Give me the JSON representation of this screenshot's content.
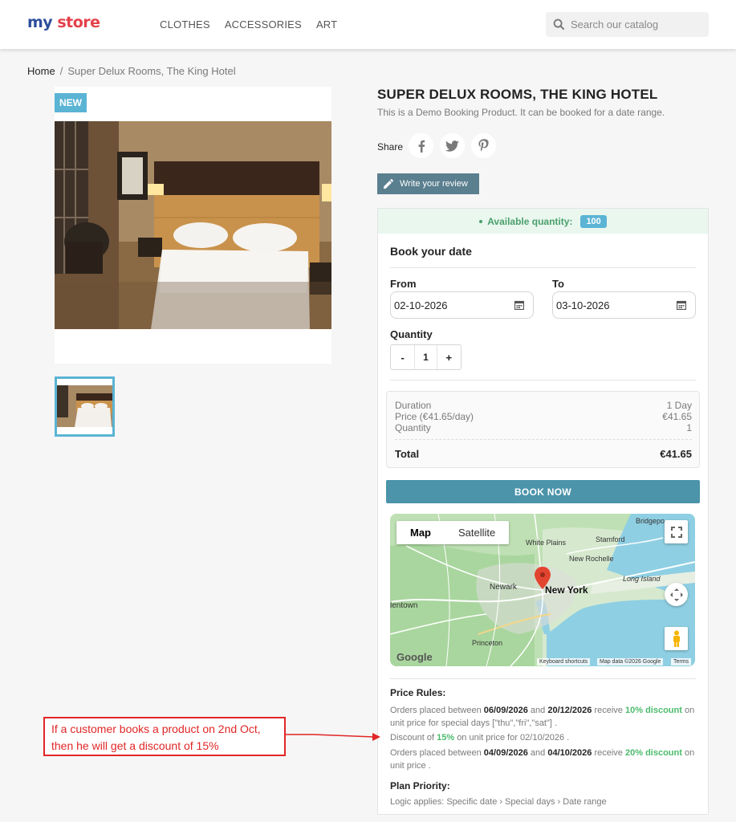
{
  "header": {
    "logo_my": "my",
    "logo_store": "store",
    "nav": [
      "CLOTHES",
      "ACCESSORIES",
      "ART"
    ],
    "search_placeholder": "Search our catalog"
  },
  "breadcrumb": {
    "home": "Home",
    "separator": "/",
    "current": "Super Delux Rooms, The King Hotel"
  },
  "product": {
    "badge": "NEW",
    "title": "SUPER DELUX ROOMS, THE KING HOTEL",
    "subtitle": "This is a Demo Booking Product. It can be booked for a date range.",
    "share_label": "Share",
    "social_icons": [
      "facebook-icon",
      "twitter-icon",
      "pinterest-icon"
    ],
    "review_button": "Write your review"
  },
  "booking": {
    "available_label": "Available quantity:",
    "available_qty": "100",
    "heading": "Book your date",
    "from_label": "From",
    "from_value": "02-10-2026",
    "to_label": "To",
    "to_value": "03-10-2026",
    "quantity_label": "Quantity",
    "qty_minus": "-",
    "qty_value": "1",
    "qty_plus": "+",
    "summary": {
      "duration_label": "Duration",
      "duration_value": "1 Day",
      "price_label": "Price (€41.65/day)",
      "price_value": "€41.65",
      "quantity_label": "Quantity",
      "quantity_value": "1",
      "total_label": "Total",
      "total_value": "€41.65"
    },
    "book_button": "BOOK NOW"
  },
  "map": {
    "type_map": "Map",
    "type_satellite": "Satellite",
    "labels": {
      "bridgeport": "Bridgepo",
      "white_plains": "White Plains",
      "stamford": "Stamford",
      "new_rochelle": "New Rochelle",
      "long_island": "Long Island",
      "newark": "Newark",
      "new_york": "New York",
      "allentown": "lentown",
      "princeton": "Princeton"
    },
    "google": "Google",
    "shortcuts": "Keyboard shortcuts",
    "map_data": "Map data ©2026 Google",
    "terms": "Terms"
  },
  "rules": {
    "title": "Price Rules:",
    "r1": {
      "pre": "Orders placed between",
      "d1": "06/09/2026",
      "and": "and",
      "d2": "20/12/2026",
      "receive": "receive",
      "disc": "10% discount",
      "post": "on unit price for special days [\"thu\",\"fri\",\"sat\"] ."
    },
    "r2": {
      "pre": "Discount of",
      "disc": "15%",
      "post": "on unit price for 02/10/2026 ."
    },
    "r3": {
      "pre": "Orders placed between",
      "d1": "04/09/2026",
      "and": "and",
      "d2": "04/10/2026",
      "receive": "receive",
      "disc": "20% discount",
      "post": "on unit price ."
    },
    "plan_title": "Plan Priority:",
    "plan_text": "Logic applies: Specific date › Special days › Date range"
  },
  "annotation": {
    "line1": "If a customer books a product on 2nd Oct,",
    "line2": "then he will get a discount of 15%"
  }
}
